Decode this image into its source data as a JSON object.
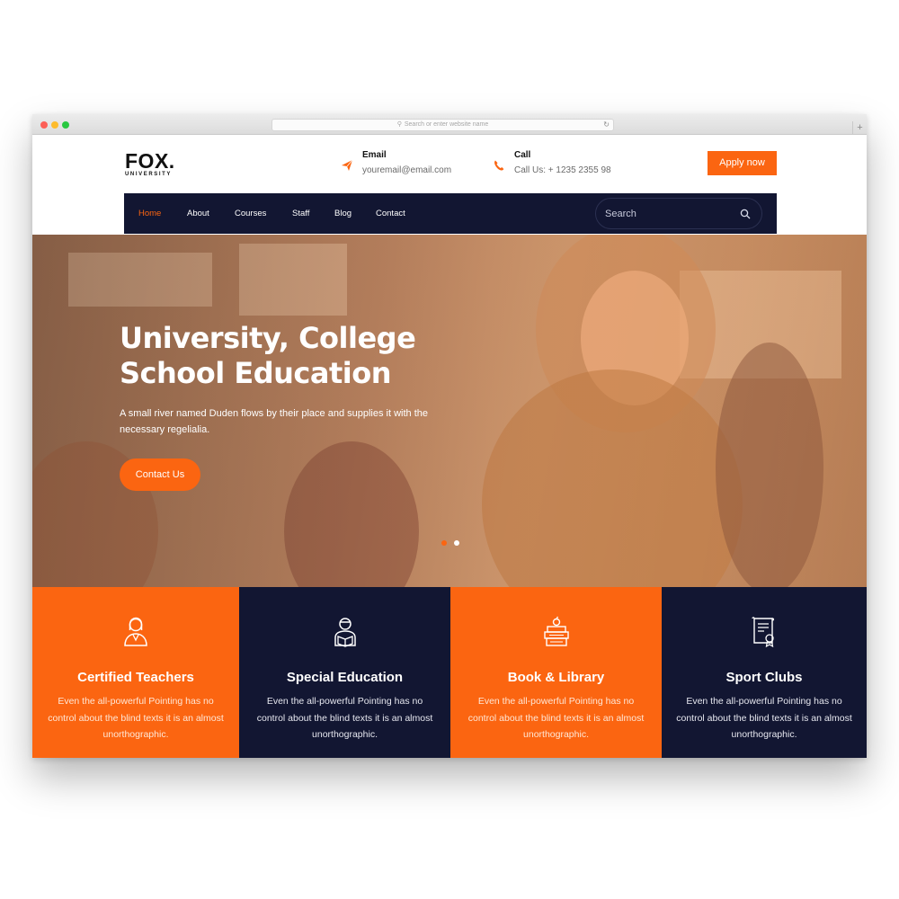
{
  "browser": {
    "url_placeholder": "Search or enter website name",
    "reload_icon": "reload-icon",
    "new_tab_label": "+"
  },
  "logo": {
    "main": "FOX.",
    "sub": "UNIVERSITY"
  },
  "header": {
    "email": {
      "title": "Email",
      "value": "youremail@email.com",
      "icon": "paper-plane-icon"
    },
    "call": {
      "title": "Call",
      "value": "Call Us: + 1235 2355 98",
      "icon": "phone-icon"
    },
    "apply_label": "Apply now"
  },
  "nav": {
    "items": [
      {
        "label": "Home",
        "active": true
      },
      {
        "label": "About"
      },
      {
        "label": "Courses"
      },
      {
        "label": "Staff"
      },
      {
        "label": "Blog"
      },
      {
        "label": "Contact"
      }
    ],
    "search_placeholder": "Search"
  },
  "hero": {
    "title_line1": "University, College",
    "title_line2": "School Education",
    "text": "A small river named Duden flows by their place and supplies it with the necessary regelialia.",
    "button_label": "Contact Us",
    "slider_active_index": 0,
    "slider_count": 2
  },
  "features": [
    {
      "title": "Certified Teachers",
      "text": "Even the all-powerful Pointing has no control about the blind texts it is an almost unorthographic.",
      "icon": "teacher-icon",
      "color": "#fb6511"
    },
    {
      "title": "Special Education",
      "text": "Even the all-powerful Pointing has no control about the blind texts it is an almost unorthographic.",
      "icon": "student-reading-icon",
      "color": "#121632"
    },
    {
      "title": "Book & Library",
      "text": "Even the all-powerful Pointing has no control about the blind texts it is an almost unorthographic.",
      "icon": "books-icon",
      "color": "#fb6511"
    },
    {
      "title": "Sport Clubs",
      "text": "Even the all-powerful Pointing has no control about the blind texts it is an almost unorthographic.",
      "icon": "certificate-icon",
      "color": "#121632"
    }
  ],
  "colors": {
    "accent": "#fb6511",
    "navy": "#121632"
  }
}
